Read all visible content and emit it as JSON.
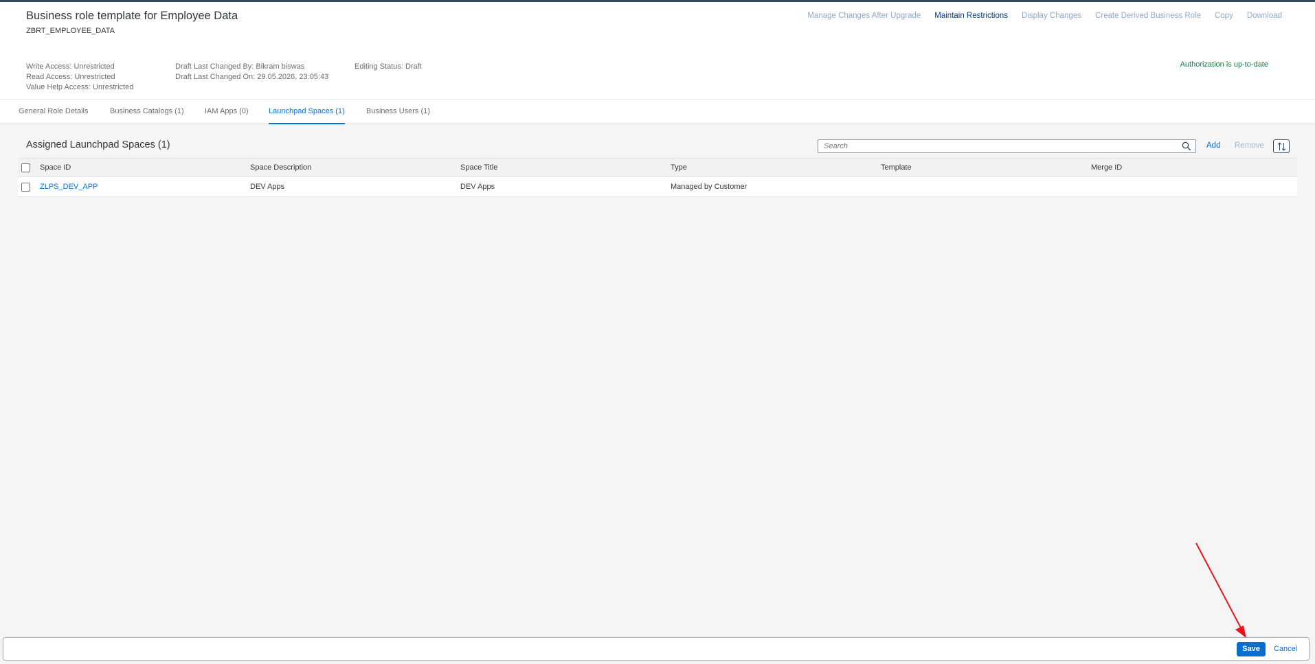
{
  "header": {
    "title": "Business role template for Employee Data",
    "subtitle": "ZBRT_EMPLOYEE_DATA",
    "actions": [
      {
        "label": "Manage Changes After Upgrade",
        "enabled": false
      },
      {
        "label": "Maintain Restrictions",
        "enabled": true
      },
      {
        "label": "Display Changes",
        "enabled": false
      },
      {
        "label": "Create Derived Business Role",
        "enabled": false
      },
      {
        "label": "Copy",
        "enabled": false
      },
      {
        "label": "Download",
        "enabled": false
      }
    ],
    "access": {
      "write": "Write Access: Unrestricted",
      "read": "Read Access: Unrestricted",
      "value_help": "Value Help Access: Unrestricted"
    },
    "draft": {
      "changed_by": "Draft Last Changed By: Bikram biswas",
      "changed_on": "Draft Last Changed On: 29.05.2026, 23:05:43"
    },
    "editing_status": "Editing Status: Draft",
    "authorization_status": "Authorization is up-to-date"
  },
  "tabs": [
    {
      "label": "General Role Details",
      "selected": false
    },
    {
      "label": "Business Catalogs (1)",
      "selected": false
    },
    {
      "label": "IAM Apps (0)",
      "selected": false
    },
    {
      "label": "Launchpad Spaces (1)",
      "selected": true
    },
    {
      "label": "Business Users (1)",
      "selected": false
    }
  ],
  "section": {
    "title": "Assigned Launchpad Spaces (1)",
    "search_placeholder": "Search",
    "add_label": "Add",
    "remove_label": "Remove",
    "sort_icon": "sort-icon"
  },
  "table": {
    "columns": [
      "Space ID",
      "Space Description",
      "Space Title",
      "Type",
      "Template",
      "Merge ID"
    ],
    "rows": [
      {
        "space_id": "ZLPS_DEV_APP",
        "description": "DEV Apps",
        "title": "DEV Apps",
        "type": "Managed by Customer",
        "template": "",
        "merge_id": ""
      }
    ]
  },
  "footer": {
    "save_label": "Save",
    "cancel_label": "Cancel"
  },
  "colors": {
    "accent": "#0a6ed1",
    "success": "#107e3e",
    "annotation_arrow": "#e8141c"
  }
}
